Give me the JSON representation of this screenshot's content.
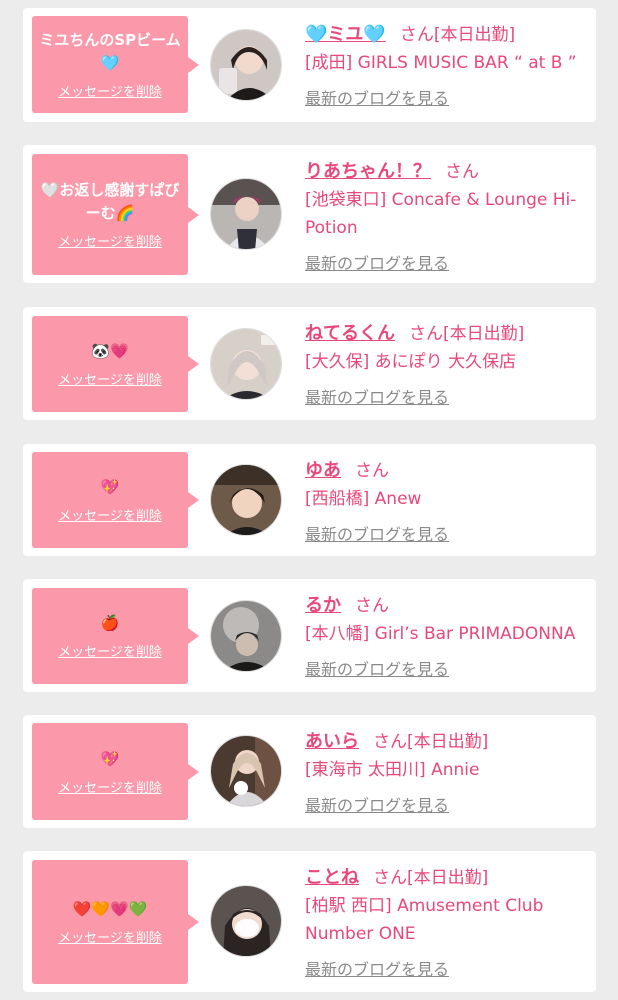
{
  "delete_label": "メッセージを削除",
  "blog_label": "最新のブログを見る",
  "honorific": "さん",
  "cards": [
    {
      "message": "ミユちんのSPビーム🩵",
      "name": "🩵ミユ🩵",
      "status": "[本日出勤]",
      "shop": "[成田] GIRLS MUSIC BAR “ at B ”"
    },
    {
      "message": "🤍お返し感謝すぱびーむ🌈",
      "name": "りあちゃん！？",
      "status": "",
      "shop": "[池袋東口] Concafe & Lounge Hi-Potion"
    },
    {
      "message": "🐼💗",
      "name": "ねてるくん",
      "status": "[本日出勤]",
      "shop": "[大久保] あにぽり 大久保店"
    },
    {
      "message": "💖",
      "name": "ゆあ",
      "status": "",
      "shop": "[西船橋] Anew"
    },
    {
      "message": "🍎",
      "name": "るか",
      "status": "",
      "shop": "[本八幡] Girl’s Bar PRIMADONNA"
    },
    {
      "message": "💖",
      "name": "あいら",
      "status": "[本日出勤]",
      "shop": "[東海市 太田川] Annie"
    },
    {
      "message": "❤️🧡💗💚",
      "name": "ことね",
      "status": "[本日出勤]",
      "shop": "[柏駅 西口] Amusement Club Number ONE"
    }
  ],
  "colors": {
    "background": "#ececec",
    "bubble": "#fb98a9",
    "link_pink": "#e8487a",
    "blog_gray": "#8a8a8a"
  }
}
